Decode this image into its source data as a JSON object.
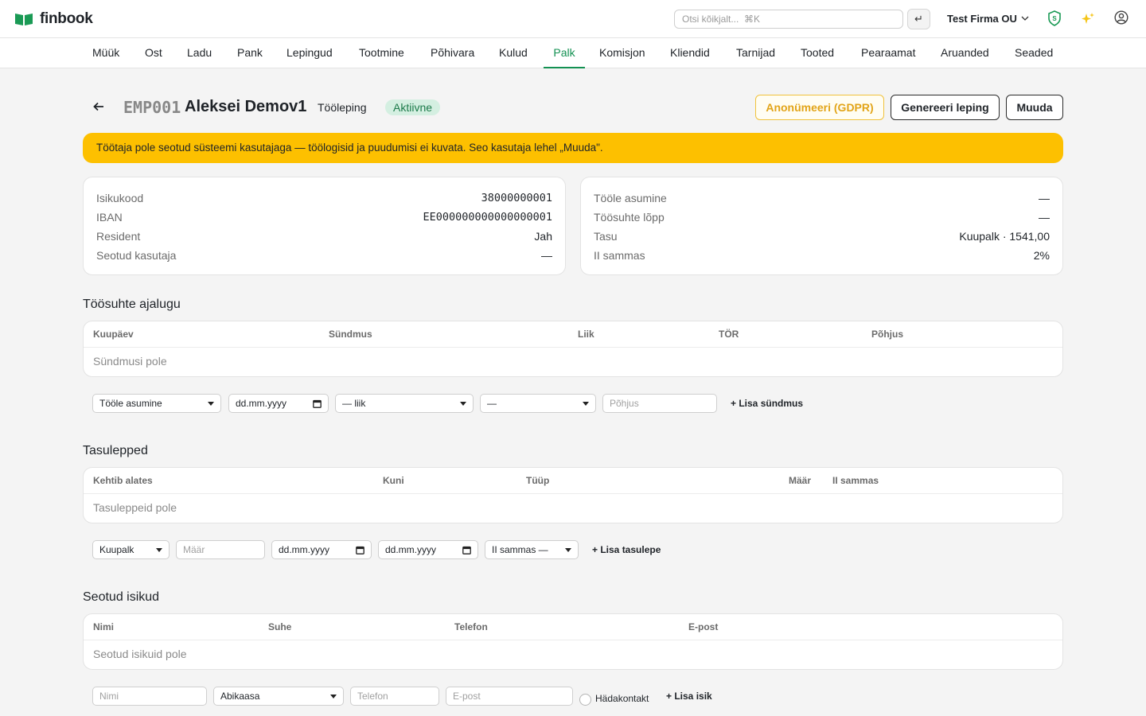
{
  "app": {
    "name": "finbook"
  },
  "topbar": {
    "search_placeholder": "Otsi kõikjalt...  ⌘K",
    "enter_symbol": "↵",
    "company": "Test Firma OU"
  },
  "nav": {
    "items": [
      "Müük",
      "Ost",
      "Ladu",
      "Pank",
      "Lepingud",
      "Tootmine",
      "Põhivara",
      "Kulud",
      "Palk",
      "Komisjon",
      "Kliendid",
      "Tarnijad",
      "Tooted",
      "Pearaamat",
      "Aruanded",
      "Seaded"
    ],
    "active": "Palk"
  },
  "header": {
    "back_symbol": "←",
    "code": "EMP001",
    "name": "Aleksei Demov1",
    "contract_type": "Tööleping",
    "status": "Aktiivne",
    "buttons": {
      "gdpr": "Anonümeeri (GDPR)",
      "generate": "Genereeri leping",
      "edit": "Muuda"
    }
  },
  "warning": "Töötaja pole seotud süsteemi kasutajaga — töölogisid ja puudumisi ei kuvata. Seo kasutaja lehel „Muuda\".",
  "details_left": [
    {
      "label": "Isikukood",
      "value": "38000000001"
    },
    {
      "label": "IBAN",
      "value": "EE000000000000000001"
    },
    {
      "label": "Resident",
      "value": "Jah"
    },
    {
      "label": "Seotud kasutaja",
      "value": "—"
    }
  ],
  "details_right": [
    {
      "label": "Tööle asumine",
      "value": "—"
    },
    {
      "label": "Töösuhte lõpp",
      "value": "—"
    },
    {
      "label": "Tasu",
      "value": "Kuupalk · 1541,00"
    },
    {
      "label": "II sammas",
      "value": "2%"
    }
  ],
  "history": {
    "title": "Töösuhte ajalugu",
    "columns": [
      "Kuupäev",
      "Sündmus",
      "Liik",
      "TÖR",
      "Põhjus"
    ],
    "empty": "Sündmusi pole",
    "form": {
      "event": "Tööle asumine",
      "date": "dd.mm.yyyy",
      "kind": "— liik",
      "tor": "—",
      "reason_placeholder": "Põhjus",
      "add": "+ Lisa sündmus"
    }
  },
  "salary": {
    "title": "Tasulepped",
    "columns": [
      "Kehtib alates",
      "Kuni",
      "Tüüp",
      "Määr",
      "II sammas"
    ],
    "empty": "Tasuleppeid pole",
    "form": {
      "type": "Kuupalk",
      "rate_placeholder": "Määr",
      "from": "dd.mm.yyyy",
      "to": "dd.mm.yyyy",
      "pillar": "II sammas —",
      "add": "+ Lisa tasulepe"
    }
  },
  "persons": {
    "title": "Seotud isikud",
    "columns": [
      "Nimi",
      "Suhe",
      "Telefon",
      "E-post"
    ],
    "empty": "Seotud isikuid pole",
    "form": {
      "name_placeholder": "Nimi",
      "relation": "Abikaasa",
      "phone_placeholder": "Telefon",
      "email_placeholder": "E-post",
      "emergency_label": "Hädakontakt",
      "add": "+ Lisa isik"
    }
  },
  "colors": {
    "brand_green": "#139152",
    "warning": "#fdc000",
    "badge_bg": "#d4efe1",
    "gdpr": "#e2a418"
  },
  "icons": [
    "book-logo-icon",
    "shield-icon",
    "sparkles-icon",
    "user-circle-icon",
    "calendar-icon",
    "chevron-down-icon",
    "arrow-left-icon"
  ]
}
